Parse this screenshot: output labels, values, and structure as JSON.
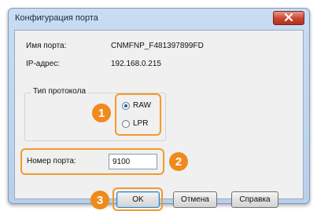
{
  "window": {
    "title": "Конфигурация порта"
  },
  "fields": {
    "port_name_label": "Имя порта:",
    "port_name_value": "CNMFNP_F481397899FD",
    "ip_label": "IP-адрес:",
    "ip_value": "192.168.0.215",
    "protocol_group_title": "Тип протокола",
    "protocol_options": [
      {
        "label": "RAW",
        "selected": true
      },
      {
        "label": "LPR",
        "selected": false
      }
    ],
    "port_number_label": "Номер порта:",
    "port_number_value": "9100"
  },
  "buttons": {
    "ok": "OK",
    "cancel": "Отмена",
    "help": "Справка"
  },
  "callouts": [
    "1",
    "2",
    "3"
  ],
  "colors": {
    "callout": "#f08a1c",
    "close_button": "#c8442e"
  }
}
